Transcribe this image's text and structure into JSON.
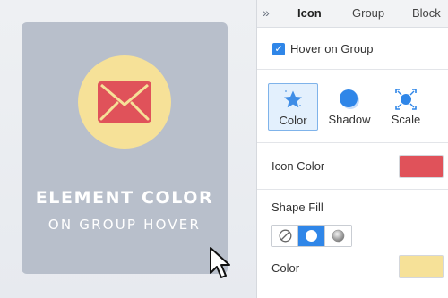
{
  "canvas": {
    "card_title": "ELEMENT COLOR",
    "card_subtitle": "ON GROUP HOVER",
    "card_bg": "#b8bfcb",
    "circle_color": "#f6e198",
    "icon_color": "#e0525a",
    "icon": "envelope-icon"
  },
  "panel": {
    "collapse_glyph": "»",
    "tabs": [
      {
        "label": "Icon",
        "active": true
      },
      {
        "label": "Group",
        "active": false
      },
      {
        "label": "Block",
        "active": false
      }
    ],
    "hover_on_group": {
      "label": "Hover on Group",
      "checked": true
    },
    "modes": [
      {
        "label": "Color",
        "icon": "star-icon",
        "selected": true
      },
      {
        "label": "Shadow",
        "icon": "shadow-circle-icon",
        "selected": false
      },
      {
        "label": "Scale",
        "icon": "scale-icon",
        "selected": false
      }
    ],
    "icon_color": {
      "label": "Icon Color",
      "value": "#e0525a"
    },
    "shape_fill": {
      "label": "Shape Fill",
      "options": [
        "none-icon",
        "solid-circle-icon",
        "gradient-circle-icon"
      ],
      "selected": "solid-circle-icon"
    },
    "fill_color": {
      "label": "Color",
      "value": "#f6e198"
    },
    "accent": "#2f86e8"
  }
}
